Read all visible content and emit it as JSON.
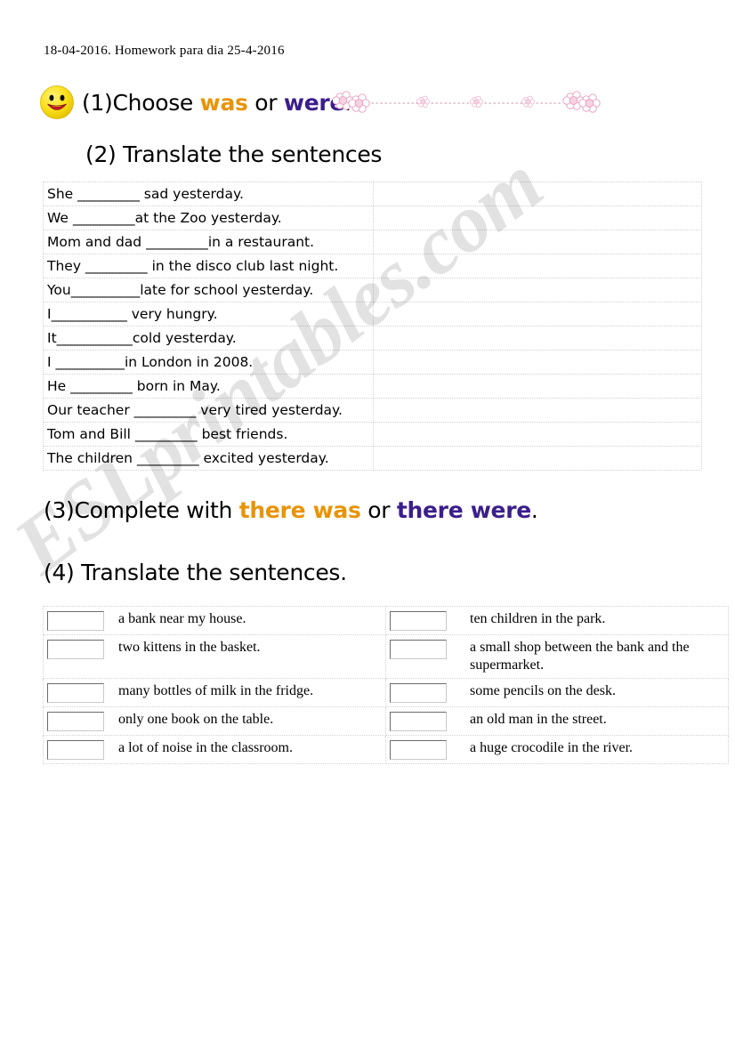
{
  "page": {
    "date_line": "18-04-2016. Homework para dia 25-4-2016",
    "watermark": "ESLprintables.com"
  },
  "headings": {
    "h1_number": "(1)",
    "h1_text_a": "Choose ",
    "h1_was": "was",
    "h1_or": " or ",
    "h1_were": "were",
    "h1_period": ".",
    "h2": "(2) Translate the sentences",
    "h3_a": "(3)Complete with ",
    "h3_was": "there was",
    "h3_or": " or ",
    "h3_were": "there were",
    "h3_period": ".",
    "h4": "(4) Translate the sentences."
  },
  "colors": {
    "was": "#E8940A",
    "were": "#3B1E8C",
    "smiley": "#F7E02A",
    "flower": "#F3C9D8",
    "border": "#d2d2d2"
  },
  "icons": {
    "smiley": "smiley-face-icon",
    "flowers": "flower-divider-icon"
  },
  "exercise1": {
    "rows": [
      "She _________  sad yesterday.",
      "We _________at the Zoo yesterday.",
      " Mom and dad _________in a restaurant.",
      "They _________ in the disco club last night.",
      " You__________late for school yesterday.",
      "I___________ very hungry.",
      "It___________cold yesterday.",
      "I __________in London in 2008.",
      "He _________ born in May.",
      "Our teacher _________ very tired yesterday.",
      "Tom and Bill _________ best friends.",
      "The children _________ excited yesterday."
    ]
  },
  "exercise2": {
    "left": [
      "a bank near my house.",
      "two kittens in the basket.",
      "many bottles of milk in the fridge.",
      "only one book on the table.",
      "a lot of noise in the classroom."
    ],
    "right": [
      "ten children in the park.",
      "a small shop between the bank and the supermarket.",
      "some pencils on the desk.",
      "an old man in the street.",
      "a huge crocodile in the river."
    ]
  }
}
